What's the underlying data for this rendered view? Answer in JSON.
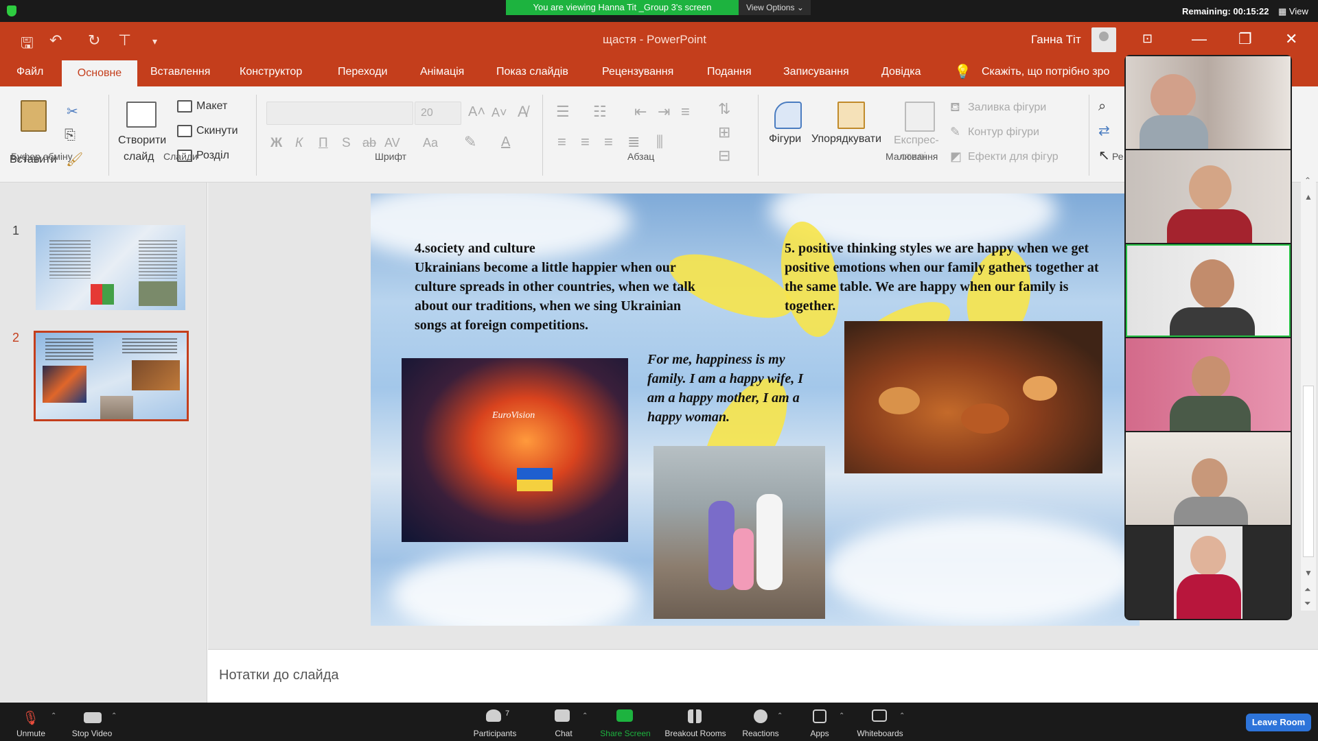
{
  "zoom_top": {
    "banner": "You are viewing Hanna Tit _Group 3's screen",
    "view_options": "View Options",
    "remaining": "Remaining: 00:15:22",
    "view": "View"
  },
  "ppt": {
    "doc_title": "щастя  -  PowerPoint",
    "user": "Ганна Тіт",
    "tabs": [
      "Файл",
      "Основне",
      "Вставлення",
      "Конструктор",
      "Переходи",
      "Анімація",
      "Показ слайдів",
      "Рецензування",
      "Подання",
      "Записування",
      "Довідка"
    ],
    "tell_me": "Скажіть, що потрібно зро",
    "ribbon": {
      "paste": "Вставити",
      "clipboard": "Буфер обміну",
      "new_slide_1": "Створити",
      "new_slide_2": "слайд",
      "layout": "Макет",
      "reset": "Скинути",
      "section": "Розділ",
      "slides_group": "Слайди",
      "font_size": "20",
      "font_group": "Шрифт",
      "paragraph_group": "Абзац",
      "shapes": "Фігури",
      "arrange": "Упорядкувати",
      "quick_styles_1": "Експрес-",
      "quick_styles_2": "стилі",
      "shape_fill": "Заливка фігури",
      "shape_outline": "Контур фігури",
      "shape_effects": "Ефекти для фігур",
      "drawing_group": "Малювання",
      "edit_group": "Ре",
      "bold": "Ж",
      "italic": "К",
      "underline": "П",
      "shadow": "S",
      "strike": "ab",
      "spacing": "AV",
      "case": "Aa"
    },
    "thumbs": [
      "1",
      "2"
    ],
    "notes": "Нотатки до слайда"
  },
  "slide": {
    "left_block": "4.society and culture\nUkrainians become a little happier when our culture spreads in other countries, when we talk about our traditions, when we sing Ukrainian songs at foreign competitions.",
    "right_block": "5. positive thinking styles  we are happy when we get positive emotions when our family gathers together at the same table. We are happy when our family is together.",
    "quote": "For me, happiness is my family. I am a happy wife, I am a happy mother, I am a happy woman.",
    "eurovision_sign": "EuroVision"
  },
  "zoom_bottom": {
    "unmute": "Unmute",
    "stop_video": "Stop Video",
    "participants": "Participants",
    "participants_count": "7",
    "chat": "Chat",
    "share_screen": "Share Screen",
    "breakout": "Breakout Rooms",
    "reactions": "Reactions",
    "apps": "Apps",
    "whiteboards": "Whiteboards",
    "leave": "Leave Room"
  },
  "colors": {
    "ppt_accent": "#c43e1c",
    "zoom_green": "#1db33f",
    "leave_blue": "#2d74da"
  }
}
